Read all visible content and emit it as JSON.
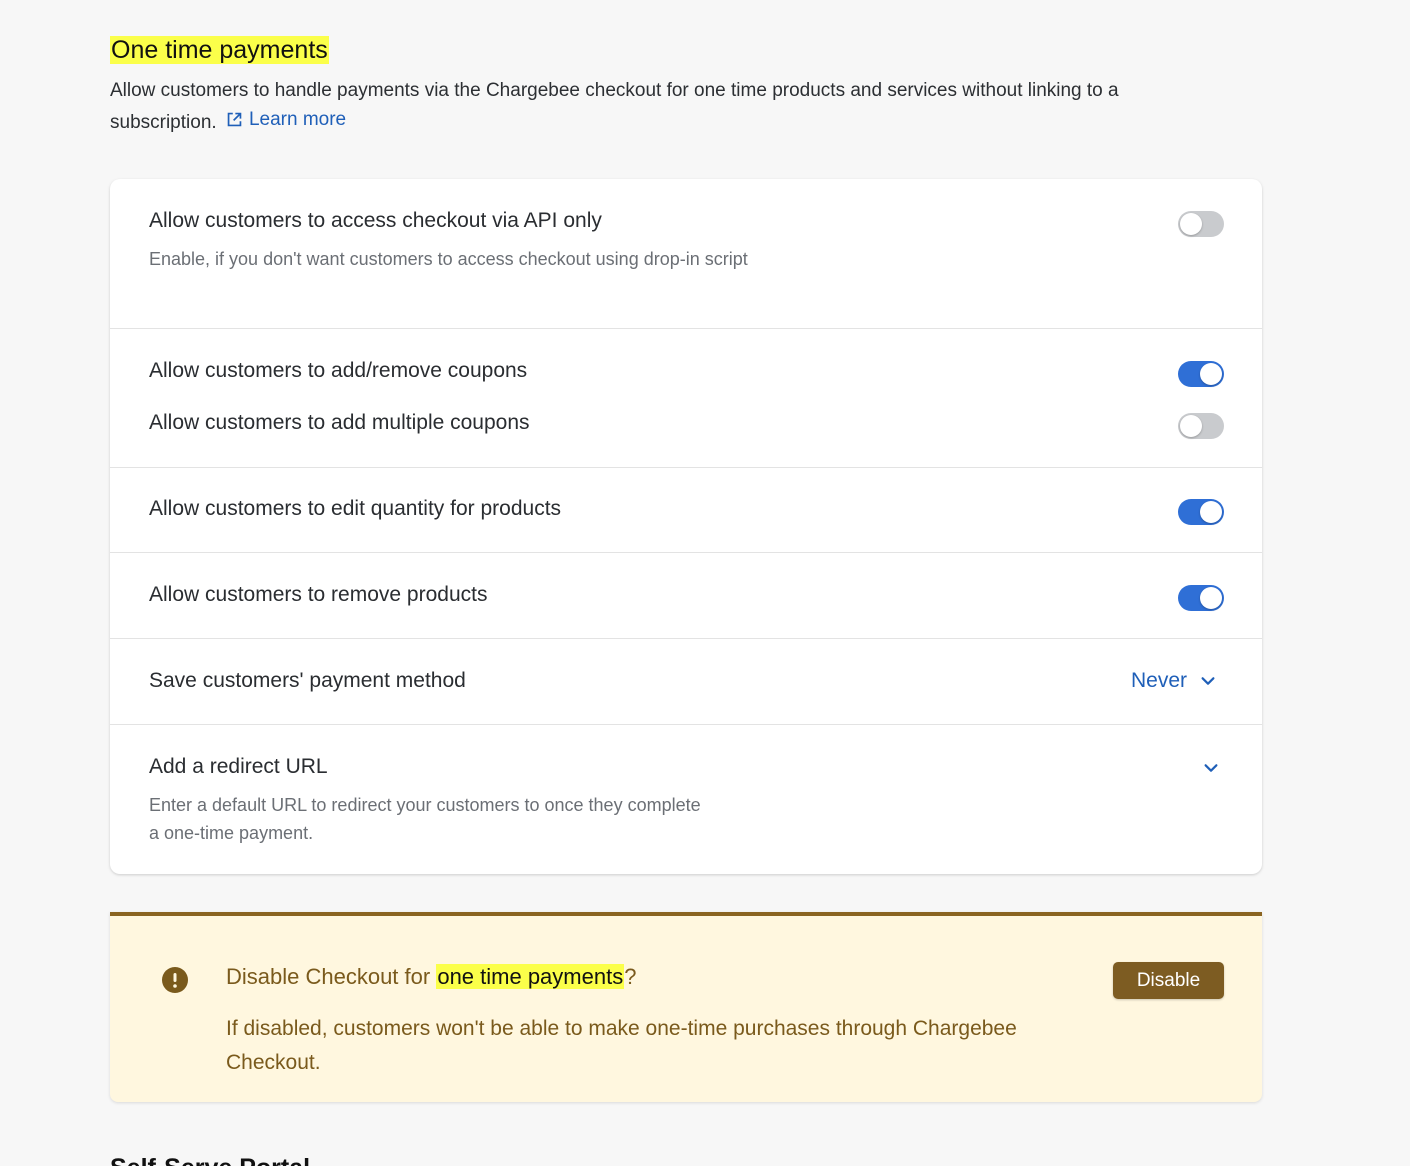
{
  "section": {
    "title": "One time payments",
    "description": "Allow customers to handle payments via the Chargebee checkout for one time products and services without linking to a subscription.",
    "learn_more": "Learn more"
  },
  "settings": [
    {
      "label": "Allow customers to access checkout via API only",
      "description": "Enable, if you don't want customers to access checkout using drop-in script",
      "enabled": false
    },
    {
      "label": "Allow customers to add/remove coupons",
      "enabled": true
    },
    {
      "label": "Allow customers to add multiple coupons",
      "enabled": false
    },
    {
      "label": "Allow customers to edit quantity for products",
      "enabled": true
    },
    {
      "label": "Allow customers to remove products",
      "enabled": true
    }
  ],
  "payment_method": {
    "label": "Save customers' payment method",
    "value": "Never"
  },
  "redirect": {
    "label": "Add a redirect URL",
    "description": "Enter a default URL to redirect your customers to once they complete a one-time payment."
  },
  "warning": {
    "title_prefix": "Disable Checkout for ",
    "title_highlight": "one time payments",
    "title_suffix": "?",
    "description": "If disabled, customers won't be able to make one-time purchases through Chargebee Checkout.",
    "button": "Disable"
  },
  "next_section": {
    "title": "Self-Serve Portal"
  },
  "colors": {
    "accent": "#2f6fd6",
    "link": "#1f5fb8",
    "warning_bg": "#fff7df",
    "warning_text": "#7a5a1c",
    "highlight": "#fbff4a"
  }
}
